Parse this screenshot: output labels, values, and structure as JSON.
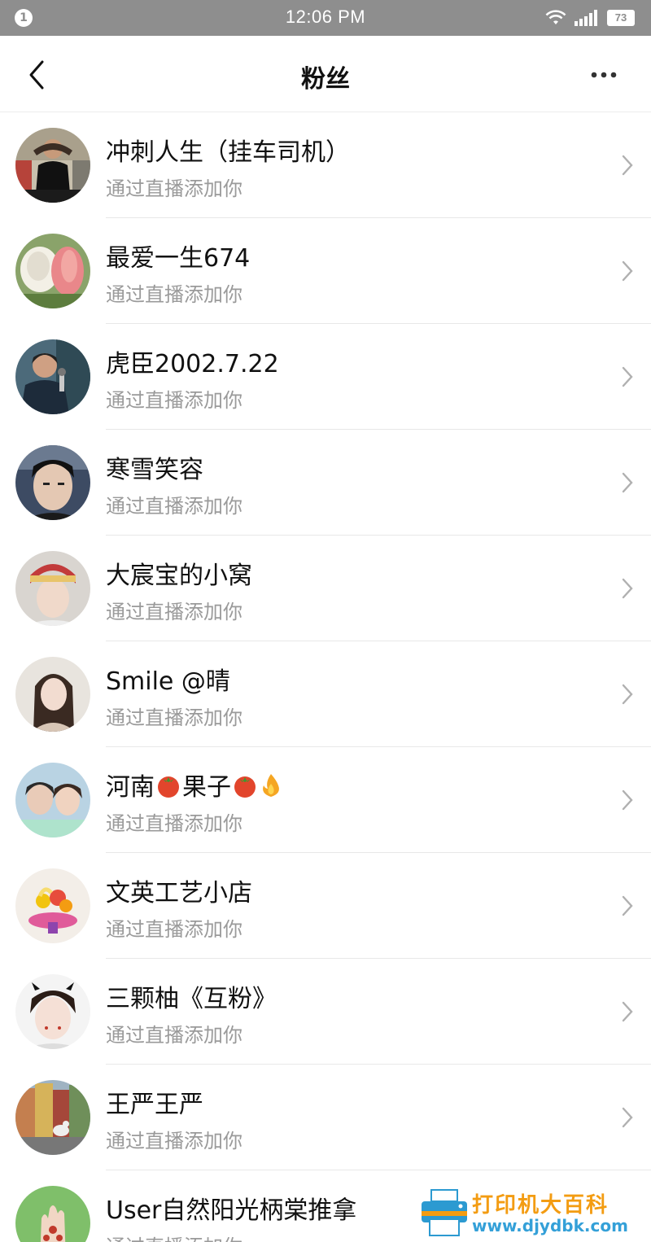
{
  "status_bar": {
    "notification_count": "1",
    "time": "12:06 PM",
    "battery": "73"
  },
  "nav": {
    "title": "粉丝",
    "back_icon": "chevron-left-icon",
    "more_icon": "more-dots-icon"
  },
  "list": {
    "items": [
      {
        "name": "冲刺人生（挂车司机）",
        "subtitle": "通过直播添加你"
      },
      {
        "name": "最爱一生674",
        "subtitle": "通过直播添加你"
      },
      {
        "name": "虎臣2002.7.22",
        "subtitle": "通过直播添加你"
      },
      {
        "name": "寒雪笑容",
        "subtitle": "通过直播添加你"
      },
      {
        "name": "大宸宝的小窝",
        "subtitle": "通过直播添加你"
      },
      {
        "name": "Smile @晴",
        "subtitle": "通过直播添加你"
      },
      {
        "name_part1": "河南",
        "name_part2": "果子",
        "subtitle": "通过直播添加你"
      },
      {
        "name": "文英工艺小店",
        "subtitle": "通过直播添加你"
      },
      {
        "name": "三颗柚《互粉》",
        "subtitle": "通过直播添加你"
      },
      {
        "name": "王严王严",
        "subtitle": "通过直播添加你"
      },
      {
        "name": "User自然阳光柄棠推拿",
        "subtitle": "通过直播添加你"
      }
    ]
  },
  "watermark": {
    "text": "打印机大百科",
    "url": "www.djydbk.com"
  },
  "colors": {
    "status_bar_bg": "#8e8e8e",
    "subtitle": "#9a9a9a",
    "divider": "#e8e8e8",
    "watermark_orange": "#f39c12",
    "watermark_blue": "#34a0d8"
  }
}
